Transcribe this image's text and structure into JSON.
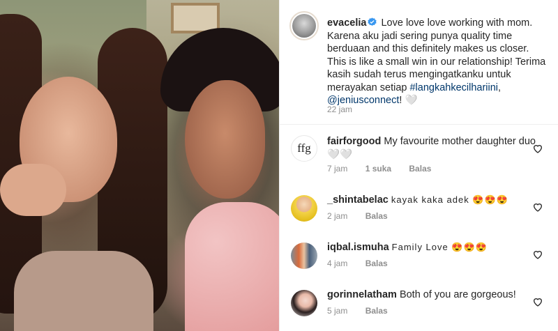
{
  "post": {
    "username": "evacelia",
    "caption_parts": {
      "text_1": "Love love love working with mom. Karena aku jadi sering punya quality time berduaan and this definitely makes us closer. This is like a small win in our relationship! Terima kasih sudah terus mengingatkanku untuk merayakan setiap",
      "hashtag": "#langkahkecilhariini",
      "sep": ",",
      "mention": "@jeniusconnect",
      "text_2": "! 🤍"
    },
    "time": "22 jam"
  },
  "comments": [
    {
      "username": "fairforgood",
      "avatar_text": "ffg",
      "text": "My favourite mother daughter duo 🤍🤍",
      "time": "7 jam",
      "likes": "1 suka",
      "reply": "Balas"
    },
    {
      "username": "_shintabelac",
      "text": "kayak kaka adek 😍😍😍",
      "time": "2 jam",
      "reply": "Balas"
    },
    {
      "username": "iqbal.ismuha",
      "text": "Family Love 😍😍😍",
      "time": "4 jam",
      "reply": "Balas"
    },
    {
      "username": "gorinnelatham",
      "text": "Both of you are gorgeous!",
      "time": "5 jam",
      "reply": "Balas"
    }
  ],
  "colors": {
    "link": "#00376b",
    "verified": "#3897f0",
    "meta": "#8e8e8e"
  },
  "icons": {
    "verified": "verified-badge-icon",
    "like": "heart-outline-icon"
  }
}
